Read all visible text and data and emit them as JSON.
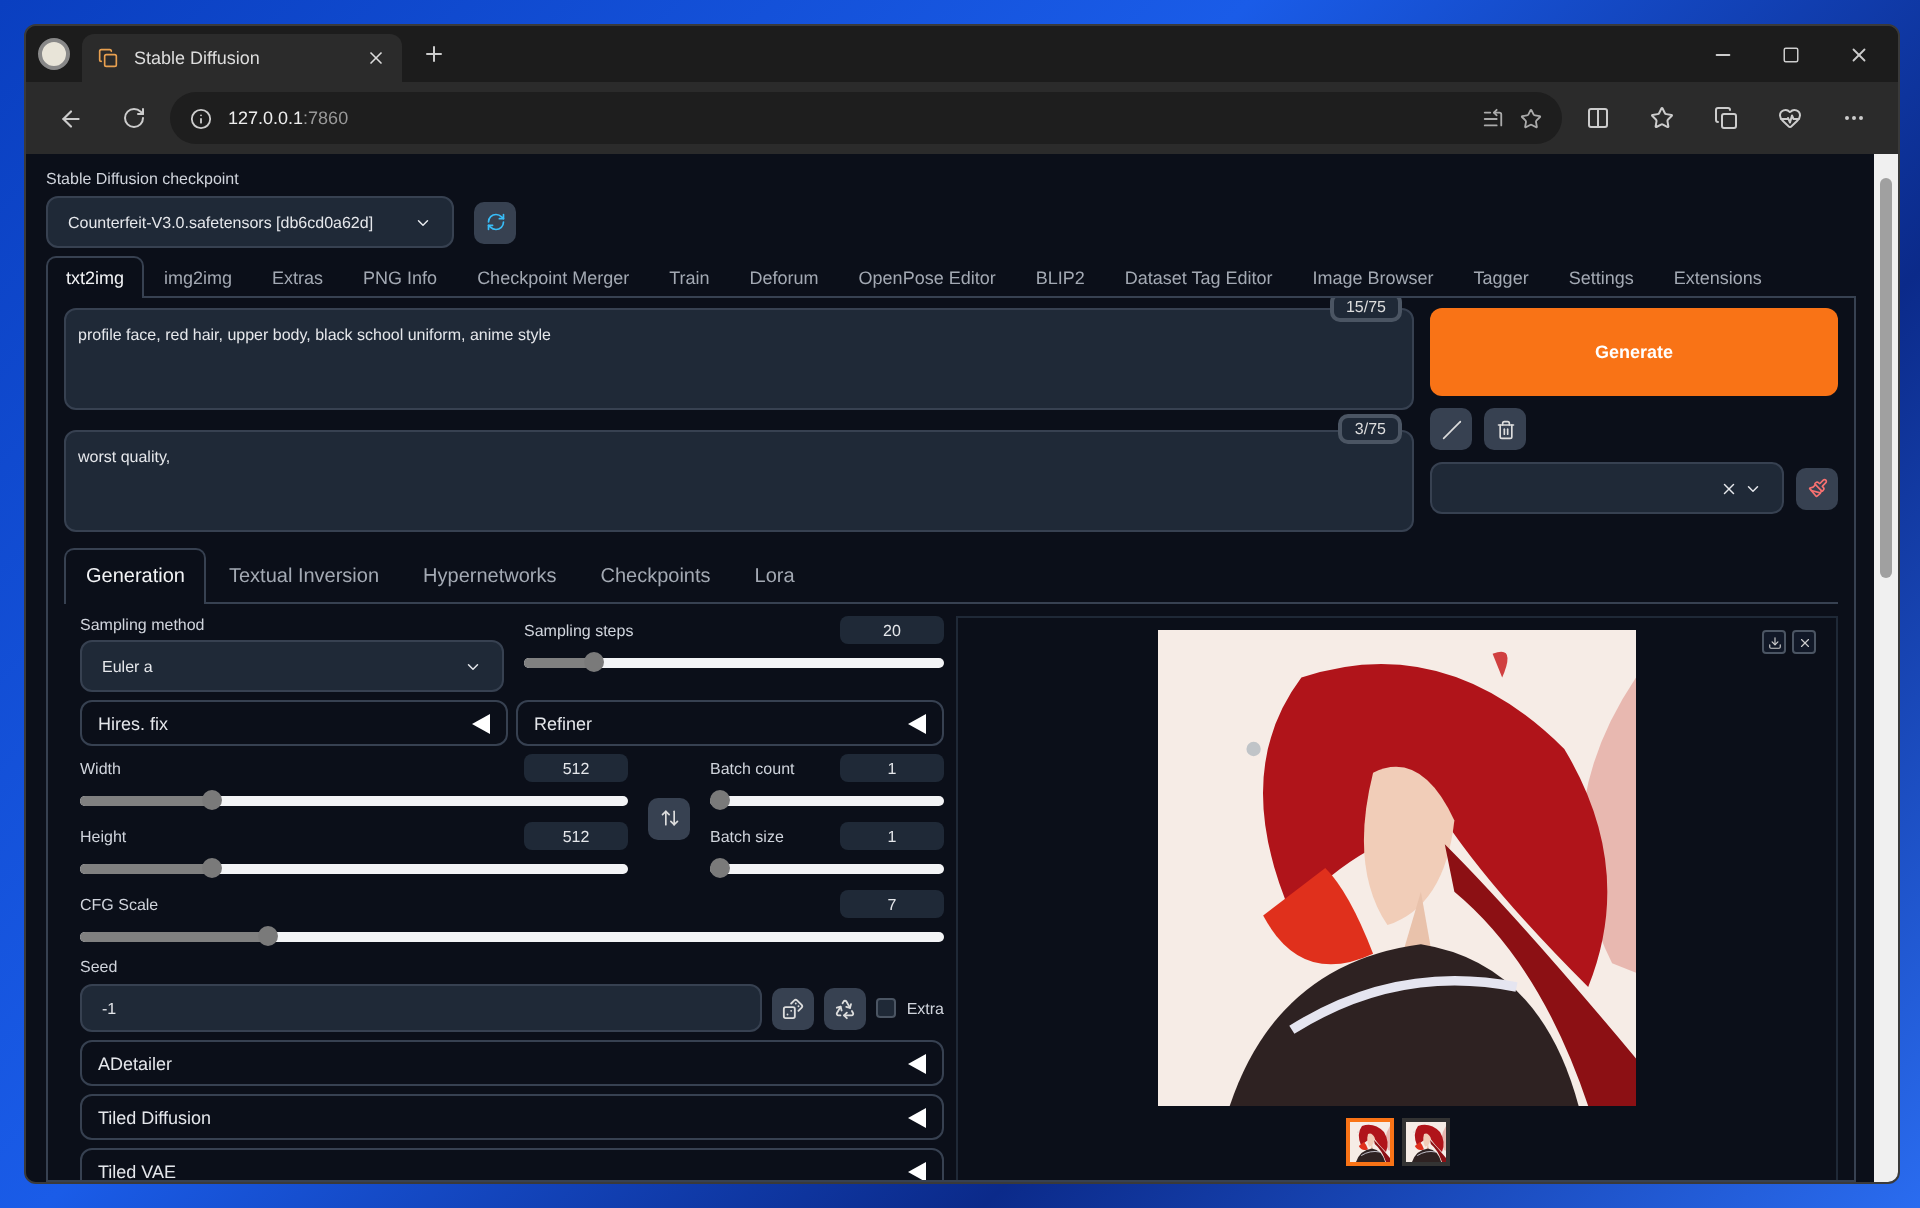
{
  "browser": {
    "tab_title": "Stable Diffusion",
    "url_host": "127.0.0.1",
    "url_port": ":7860"
  },
  "checkpoint": {
    "label": "Stable Diffusion checkpoint",
    "value": "Counterfeit-V3.0.safetensors [db6cd0a62d]"
  },
  "main_tabs": [
    {
      "label": "txt2img",
      "selected": true
    },
    {
      "label": "img2img",
      "selected": false
    },
    {
      "label": "Extras",
      "selected": false
    },
    {
      "label": "PNG Info",
      "selected": false
    },
    {
      "label": "Checkpoint Merger",
      "selected": false
    },
    {
      "label": "Train",
      "selected": false
    },
    {
      "label": "Deforum",
      "selected": false
    },
    {
      "label": "OpenPose Editor",
      "selected": false
    },
    {
      "label": "BLIP2",
      "selected": false
    },
    {
      "label": "Dataset Tag Editor",
      "selected": false
    },
    {
      "label": "Image Browser",
      "selected": false
    },
    {
      "label": "Tagger",
      "selected": false
    },
    {
      "label": "Settings",
      "selected": false
    },
    {
      "label": "Extensions",
      "selected": false
    }
  ],
  "prompt": {
    "value": "profile face, red hair, upper body, black school uniform, anime style",
    "token_count": "15/75"
  },
  "negative_prompt": {
    "value": "worst quality,",
    "token_count": "3/75"
  },
  "generate_button": "Generate",
  "sub_tabs": [
    {
      "label": "Generation",
      "selected": true
    },
    {
      "label": "Textual Inversion",
      "selected": false
    },
    {
      "label": "Hypernetworks",
      "selected": false
    },
    {
      "label": "Checkpoints",
      "selected": false
    },
    {
      "label": "Lora",
      "selected": false
    }
  ],
  "sampling_method": {
    "label": "Sampling method",
    "value": "Euler a"
  },
  "sampling_steps": {
    "label": "Sampling steps",
    "value": "20",
    "level": 0.15
  },
  "hires_fix": {
    "label": "Hires. fix",
    "expanded": false
  },
  "refiner": {
    "label": "Refiner",
    "expanded": false
  },
  "width": {
    "label": "Width",
    "value": "512",
    "level": 0.23
  },
  "height": {
    "label": "Height",
    "value": "512",
    "level": 0.23
  },
  "batch_count": {
    "label": "Batch count",
    "value": "1",
    "level": 0
  },
  "batch_size": {
    "label": "Batch size",
    "value": "1",
    "level": 0
  },
  "cfg_scale": {
    "label": "CFG Scale",
    "value": "7",
    "level": 0.21
  },
  "seed": {
    "label": "Seed",
    "value": "-1",
    "extra": {
      "label": "Extra",
      "checked": false
    }
  },
  "accordions": [
    {
      "label": "ADetailer",
      "expanded": false
    },
    {
      "label": "Tiled Diffusion",
      "expanded": false
    },
    {
      "label": "Tiled VAE",
      "expanded": false
    }
  ],
  "gallery": {
    "thumbnails": [
      {
        "selected": true
      },
      {
        "selected": false
      }
    ]
  }
}
